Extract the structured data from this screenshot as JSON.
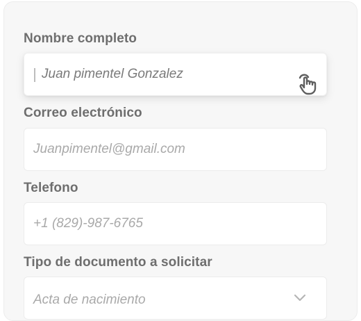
{
  "form": {
    "full_name": {
      "label": "Nombre completo",
      "value": "Juan pimentel Gonzalez"
    },
    "email": {
      "label": "Correo electrónico",
      "placeholder": "Juanpimentel@gmail.com"
    },
    "phone": {
      "label": "Telefono",
      "placeholder": "+1 (829)-987-6765"
    },
    "document_type": {
      "label": "Tipo de documento a solicitar",
      "selected": "Acta de nacimiento"
    }
  },
  "icons": {
    "cursor": "pointer-hand-icon",
    "dropdown": "chevron-down-icon"
  },
  "colors": {
    "label": "#6e6e6e",
    "placeholder": "#a9a9a9",
    "value": "#7a7a7a",
    "card_bg": "#f7f7f7"
  }
}
